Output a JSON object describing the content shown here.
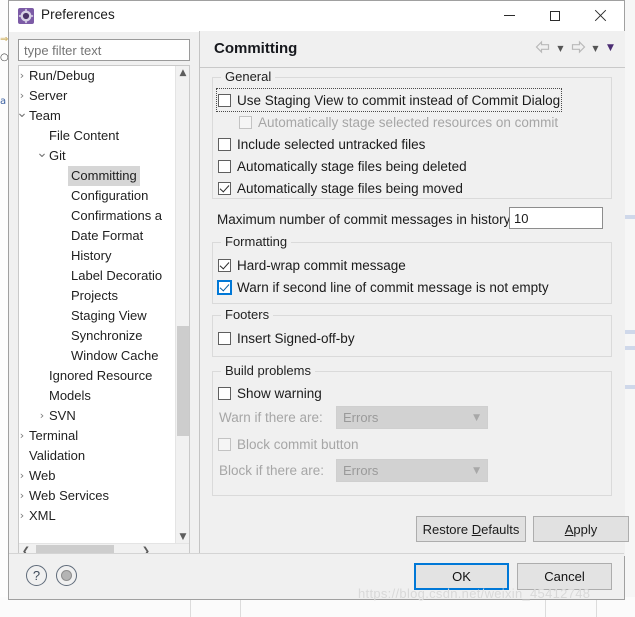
{
  "window": {
    "title": "Preferences",
    "icon": "gear-icon",
    "minimize_label": "Minimize",
    "maximize_label": "Maximize",
    "close_label": "Close"
  },
  "filter": {
    "placeholder": "type filter text",
    "value": ""
  },
  "tree": {
    "selected": "Committing",
    "items": [
      {
        "label": "Run/Debug",
        "indent": 0,
        "twisty": "collapsed"
      },
      {
        "label": "Server",
        "indent": 0,
        "twisty": "collapsed"
      },
      {
        "label": "Team",
        "indent": 0,
        "twisty": "expanded"
      },
      {
        "label": "File Content",
        "indent": 1,
        "twisty": "none"
      },
      {
        "label": "Git",
        "indent": 1,
        "twisty": "expanded"
      },
      {
        "label": "Committing",
        "indent": 2,
        "twisty": "none"
      },
      {
        "label": "Configuration",
        "indent": 2,
        "twisty": "none"
      },
      {
        "label": "Confirmations a",
        "indent": 2,
        "twisty": "none"
      },
      {
        "label": "Date Format",
        "indent": 2,
        "twisty": "none"
      },
      {
        "label": "History",
        "indent": 2,
        "twisty": "none"
      },
      {
        "label": "Label Decoratio",
        "indent": 2,
        "twisty": "none"
      },
      {
        "label": "Projects",
        "indent": 2,
        "twisty": "none"
      },
      {
        "label": "Staging View",
        "indent": 2,
        "twisty": "none"
      },
      {
        "label": "Synchronize",
        "indent": 2,
        "twisty": "none"
      },
      {
        "label": "Window Cache",
        "indent": 2,
        "twisty": "none"
      },
      {
        "label": "Ignored Resource",
        "indent": 1,
        "twisty": "none"
      },
      {
        "label": "Models",
        "indent": 1,
        "twisty": "none"
      },
      {
        "label": "SVN",
        "indent": 1,
        "twisty": "collapsed"
      },
      {
        "label": "Terminal",
        "indent": 0,
        "twisty": "collapsed"
      },
      {
        "label": "Validation",
        "indent": 0,
        "twisty": "none"
      },
      {
        "label": "Web",
        "indent": 0,
        "twisty": "collapsed"
      },
      {
        "label": "Web Services",
        "indent": 0,
        "twisty": "collapsed"
      },
      {
        "label": "XML",
        "indent": 0,
        "twisty": "collapsed"
      }
    ]
  },
  "page": {
    "title": "Committing",
    "nav": {
      "back_label": "Back",
      "back_dropdown_label": "Back history",
      "forward_label": "Forward",
      "forward_dropdown_label": "Forward history",
      "menu_label": "View menu"
    },
    "groups": {
      "general": {
        "legend": "General",
        "options": [
          {
            "label": "Use Staging View to commit instead of Commit Dialog",
            "checked": false,
            "enabled": true,
            "focused": true
          },
          {
            "label": "Automatically stage selected resources on commit",
            "checked": false,
            "enabled": false,
            "focused": false
          },
          {
            "label": "Include selected untracked files",
            "checked": false,
            "enabled": true,
            "focused": false
          },
          {
            "label": "Automatically stage files being deleted",
            "checked": false,
            "enabled": true,
            "focused": false
          },
          {
            "label": "Automatically stage files being moved",
            "checked": true,
            "enabled": true,
            "focused": false
          }
        ],
        "max_messages_label": "Maximum number of commit messages in history:",
        "max_messages_value": "10"
      },
      "formatting": {
        "legend": "Formatting",
        "options": [
          {
            "label": "Hard-wrap commit message",
            "checked": true,
            "enabled": true,
            "focused": false
          },
          {
            "label": "Warn if second line of commit message is not empty",
            "checked": true,
            "enabled": true,
            "focused": true
          }
        ]
      },
      "footers": {
        "legend": "Footers",
        "options": [
          {
            "label": "Insert Signed-off-by",
            "checked": false,
            "enabled": true,
            "focused": false
          }
        ]
      },
      "build_problems": {
        "legend": "Build problems",
        "show_warning": {
          "label": "Show warning",
          "checked": false,
          "enabled": true
        },
        "warn_if_label": "Warn if there are:",
        "warn_if_value": "Errors",
        "block_commit": {
          "label": "Block commit button",
          "checked": false,
          "enabled": false
        },
        "block_if_label": "Block if there are:",
        "block_if_value": "Errors"
      }
    },
    "restore_defaults_label": "Restore Defaults",
    "restore_defaults_mnemonic": "D",
    "apply_label": "Apply",
    "apply_mnemonic": "A"
  },
  "footer": {
    "help_icon": "question-mark-icon",
    "extra_icon": "circle-icon",
    "ok_label": "OK",
    "cancel_label": "Cancel"
  },
  "watermark": "https://blog.csdn.net/weixin_45412748",
  "colors": {
    "accent": "#0078d7",
    "dialog_bg": "#f0f0f0",
    "selection": "#d6d6d6",
    "brand_purple": "#4b2d73"
  }
}
